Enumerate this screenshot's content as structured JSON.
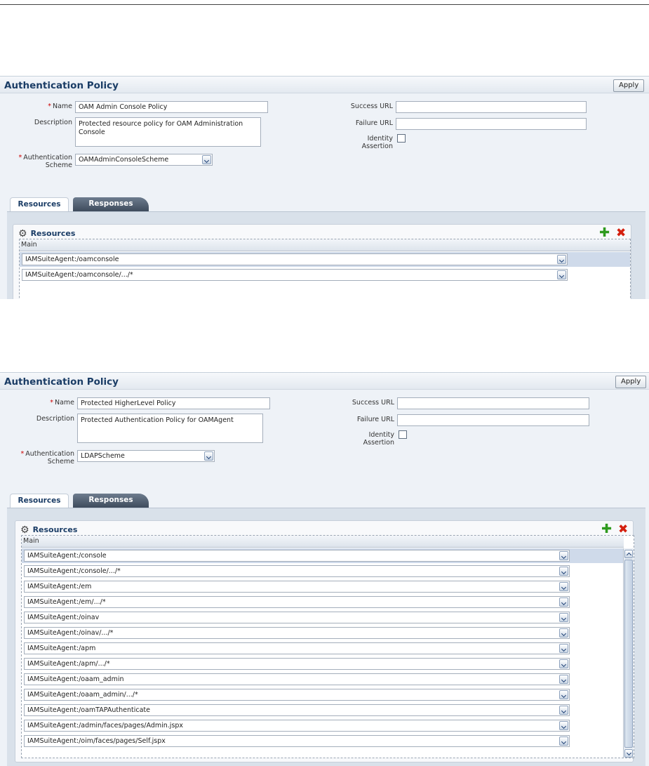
{
  "panel1": {
    "title": "Authentication Policy",
    "apply_label": "Apply",
    "name_label": "Name",
    "name_value": "OAM Admin Console Policy",
    "description_label": "Description",
    "description_value": "Protected resource policy for OAM Administration Console",
    "auth_scheme_label_1": "Authentication",
    "auth_scheme_label_2": "Scheme",
    "auth_scheme_value": "OAMAdminConsoleScheme",
    "success_url_label": "Success URL",
    "success_url_value": "",
    "failure_url_label": "Failure URL",
    "failure_url_value": "",
    "identity_label_1": "Identity",
    "identity_label_2": "Assertion",
    "tab_resources": "Resources",
    "tab_responses": "Responses",
    "resources_title": "Resources",
    "column_header": "Main",
    "rows": [
      "IAMSuiteAgent:/oamconsole",
      "IAMSuiteAgent:/oamconsole/.../*"
    ]
  },
  "panel2": {
    "title": "Authentication Policy",
    "apply_label": "Apply",
    "name_label": "Name",
    "name_value": "Protected HigherLevel Policy",
    "description_label": "Description",
    "description_value": "Protected Authentication Policy for OAMAgent",
    "auth_scheme_label_1": "Authentication",
    "auth_scheme_label_2": "Scheme",
    "auth_scheme_value": "LDAPScheme",
    "success_url_label": "Success URL",
    "success_url_value": "",
    "failure_url_label": "Failure URL",
    "failure_url_value": "",
    "identity_label_1": "Identity",
    "identity_label_2": "Assertion",
    "tab_resources": "Resources",
    "tab_responses": "Responses",
    "resources_title": "Resources",
    "column_header": "Main",
    "rows": [
      "IAMSuiteAgent:/console",
      "IAMSuiteAgent:/console/.../*",
      "IAMSuiteAgent:/em",
      "IAMSuiteAgent:/em/.../*",
      "IAMSuiteAgent:/oinav",
      "IAMSuiteAgent:/oinav/.../*",
      "IAMSuiteAgent:/apm",
      "IAMSuiteAgent:/apm/.../*",
      "IAMSuiteAgent:/oaam_admin",
      "IAMSuiteAgent:/oaam_admin/.../*",
      "IAMSuiteAgent:/oamTAPAuthenticate",
      "IAMSuiteAgent:/admin/faces/pages/Admin.jspx",
      "IAMSuiteAgent:/oim/faces/pages/Self.jspx"
    ]
  },
  "icons": {
    "resources": "gear-icon",
    "add": "add-icon",
    "delete": "delete-icon",
    "dropdown": "chevron-down-icon"
  }
}
